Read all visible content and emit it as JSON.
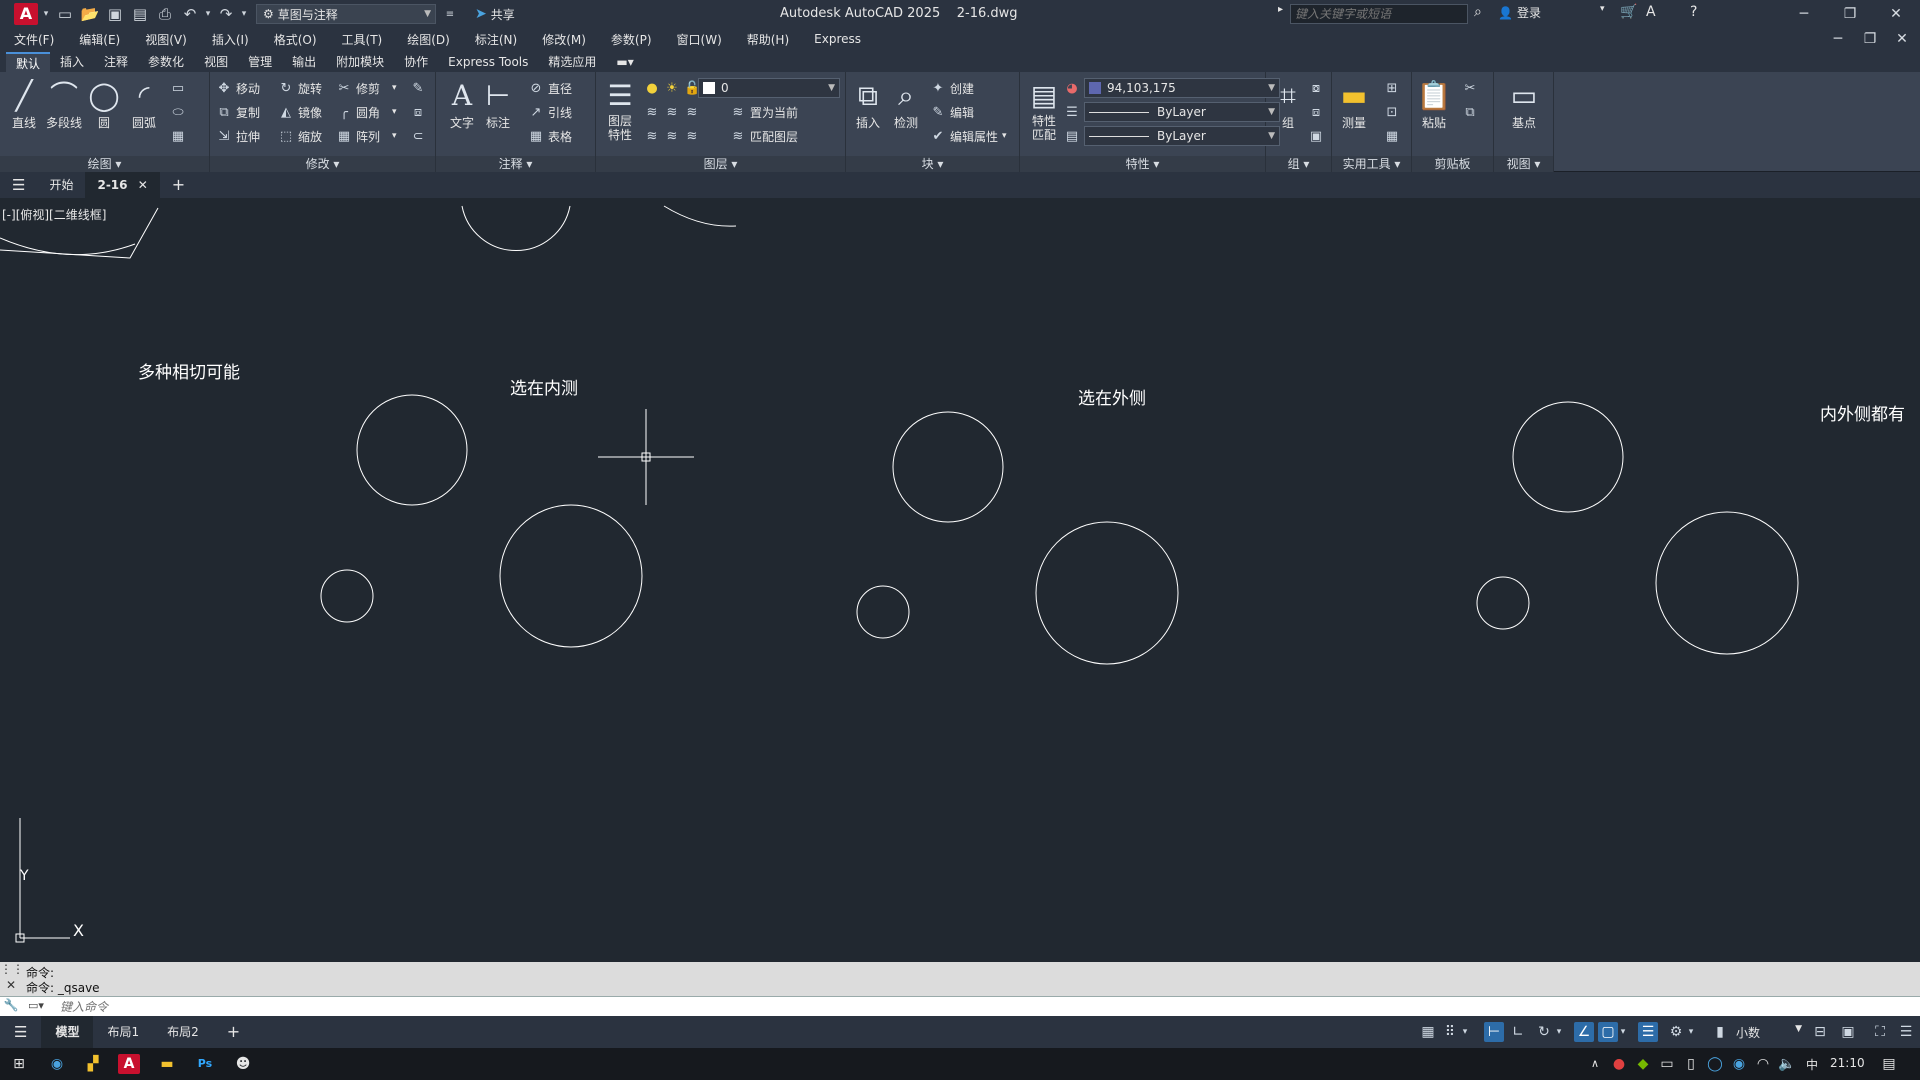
{
  "title_bar": {
    "workspace": "草图与注释",
    "share_label": "共享",
    "title": "Autodesk AutoCAD 2025    2-16.dwg",
    "search_placeholder": "键入关键字或短语",
    "login_label": "登录"
  },
  "menu": [
    "文件(F)",
    "编辑(E)",
    "视图(V)",
    "插入(I)",
    "格式(O)",
    "工具(T)",
    "绘图(D)",
    "标注(N)",
    "修改(M)",
    "参数(P)",
    "窗口(W)",
    "帮助(H)",
    "Express"
  ],
  "ribbon_tabs": [
    "默认",
    "插入",
    "注释",
    "参数化",
    "视图",
    "管理",
    "输出",
    "附加模块",
    "协作",
    "Express Tools",
    "精选应用"
  ],
  "ribbon": {
    "draw": {
      "title": "绘图 ▾",
      "line": "直线",
      "polyline": "多段线",
      "circle": "圆",
      "arc": "圆弧"
    },
    "modify": {
      "title": "修改 ▾",
      "move": "移动",
      "rotate": "旋转",
      "trim": "修剪",
      "copy": "复制",
      "mirror": "镜像",
      "fillet": "圆角",
      "stretch": "拉伸",
      "scale": "缩放",
      "array": "阵列"
    },
    "annotation": {
      "title": "注释 ▾",
      "text": "文字",
      "dimension": "标注",
      "diameter": "直径",
      "leader": "引线",
      "table": "表格"
    },
    "layers": {
      "title": "图层 ▾",
      "props": "图层\n特性",
      "layer_value": "0",
      "set_current": "置为当前",
      "match_layer": "匹配图层"
    },
    "block": {
      "title": "块 ▾",
      "insert": "插入",
      "detect": "检测",
      "create": "创建",
      "edit": "编辑",
      "edit_attr": "编辑属性"
    },
    "properties": {
      "title": "特性 ▾",
      "match": "特性\n匹配",
      "color_value": "94,103,175",
      "linetype": "ByLayer",
      "lineweight": "ByLayer"
    },
    "group": {
      "title": "组 ▾",
      "group": "组"
    },
    "utilities": {
      "title": "实用工具 ▾",
      "measure": "测量"
    },
    "clipboard": {
      "title": "剪贴板",
      "paste": "粘贴"
    },
    "view": {
      "title": "视图 ▾",
      "base": "基点"
    }
  },
  "doc_tabs": {
    "start": "开始",
    "active": "2-16"
  },
  "canvas": {
    "viewport_label": "[-][俯视][二维线框]",
    "labels": {
      "multi": "多种相切可能",
      "inner": "选在内测",
      "outer": "选在外侧",
      "both": "内外侧都有"
    },
    "ucs_y": "Y",
    "ucs_x": "X"
  },
  "command": {
    "history": [
      "命令:",
      "命令: _qsave"
    ],
    "placeholder": "键入命令"
  },
  "layout_tabs": [
    "模型",
    "布局1",
    "布局2"
  ],
  "status": {
    "units": "小数"
  },
  "taskbar": {
    "ime": "中",
    "clock": "21:10"
  },
  "colors": {
    "accent": "#4a90d9",
    "canvas_bg": "#212830",
    "layer_color": "#5e67af"
  }
}
